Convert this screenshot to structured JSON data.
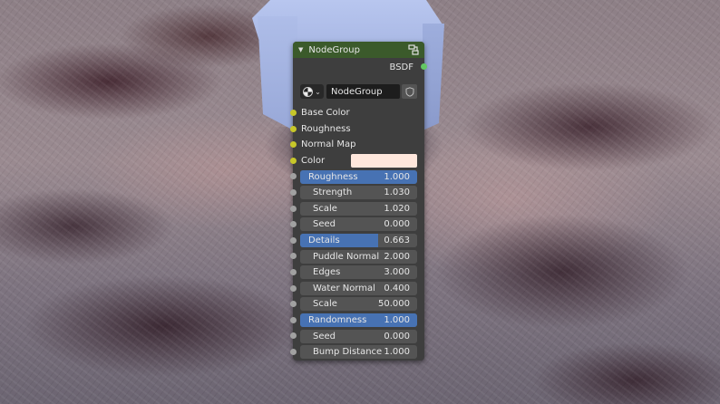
{
  "node": {
    "title": "NodeGroup",
    "output_label": "BSDF",
    "group_name": "NodeGroup",
    "color_swatch": "#ffe7dc",
    "header_color": "#3b5a2b",
    "slider_color": "#4772b3",
    "inputs": [
      {
        "label": "Base Color"
      },
      {
        "label": "Roughness"
      },
      {
        "label": "Normal Map"
      }
    ],
    "color_input": {
      "label": "Color"
    },
    "fields": [
      {
        "label": "Roughness",
        "value": "1.000",
        "slider": true,
        "fraction": 1.0
      },
      {
        "label": "Strength",
        "value": "1.030",
        "slider": false
      },
      {
        "label": "Scale",
        "value": "1.020",
        "slider": false
      },
      {
        "label": "Seed",
        "value": "0.000",
        "slider": false
      },
      {
        "label": "Details",
        "value": "0.663",
        "slider": true,
        "fraction": 0.663
      },
      {
        "label": "Puddle Normal",
        "value": "2.000",
        "slider": false
      },
      {
        "label": "Edges",
        "value": "3.000",
        "slider": false
      },
      {
        "label": "Water Normal",
        "value": "0.400",
        "slider": false
      },
      {
        "label": "Scale",
        "value": "50.000",
        "slider": false
      },
      {
        "label": "Randomness",
        "value": "1.000",
        "slider": true,
        "fraction": 1.0
      },
      {
        "label": "Seed",
        "value": "0.000",
        "slider": false
      },
      {
        "label": "Bump Distance",
        "value": "1.000",
        "slider": false
      }
    ]
  }
}
